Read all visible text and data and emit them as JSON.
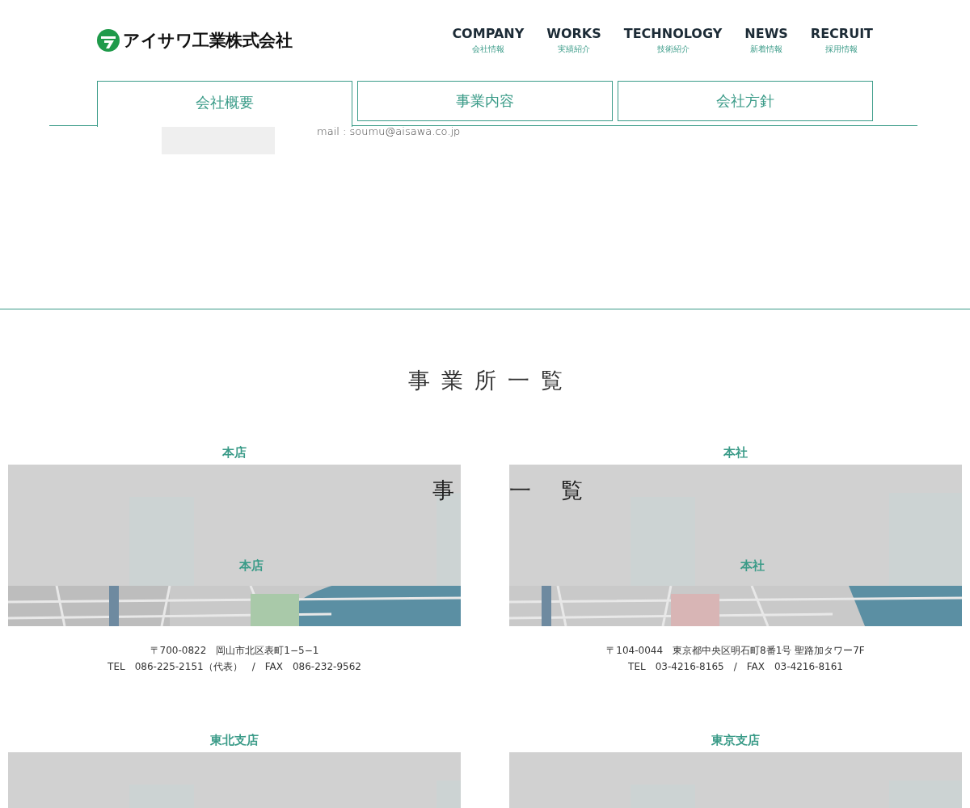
{
  "header": {
    "logo_text": "アイサワ工業株式会社",
    "nav": [
      {
        "label": "COMPANY",
        "sub": "会社情報"
      },
      {
        "label": "WORKS",
        "sub": "実績紹介"
      },
      {
        "label": "TECHNOLOGY",
        "sub": "技術紹介"
      },
      {
        "label": "NEWS",
        "sub": "新着情報"
      },
      {
        "label": "RECRUIT",
        "sub": "採用情報"
      }
    ]
  },
  "tabs": [
    {
      "label": "会社概要",
      "selected": true
    },
    {
      "label": "事業内容",
      "selected": false
    },
    {
      "label": "会社方針",
      "selected": false
    }
  ],
  "contact": {
    "mail": "mail : soumu@aisawa.co.jp"
  },
  "offices_section": {
    "title": "事業所一覧",
    "offices": [
      {
        "name": "本店",
        "overlay_name": "本店",
        "overlay_heading": "事",
        "address": "〒700-0822　岡山市北区表町1−5−1",
        "phone": "TEL　086-225-2151（代表）　/　FAX　086-232-9562"
      },
      {
        "name": "本社",
        "overlay_name": "本社",
        "overlay_heading": "一 覧",
        "address": "〒104-0044　東京都中央区明石町8番1号 聖路加タワー7F",
        "phone": "TEL　03-4216-8165　/　FAX　03-4216-8161"
      },
      {
        "name": "東北支店"
      },
      {
        "name": "東京支店"
      }
    ]
  }
}
